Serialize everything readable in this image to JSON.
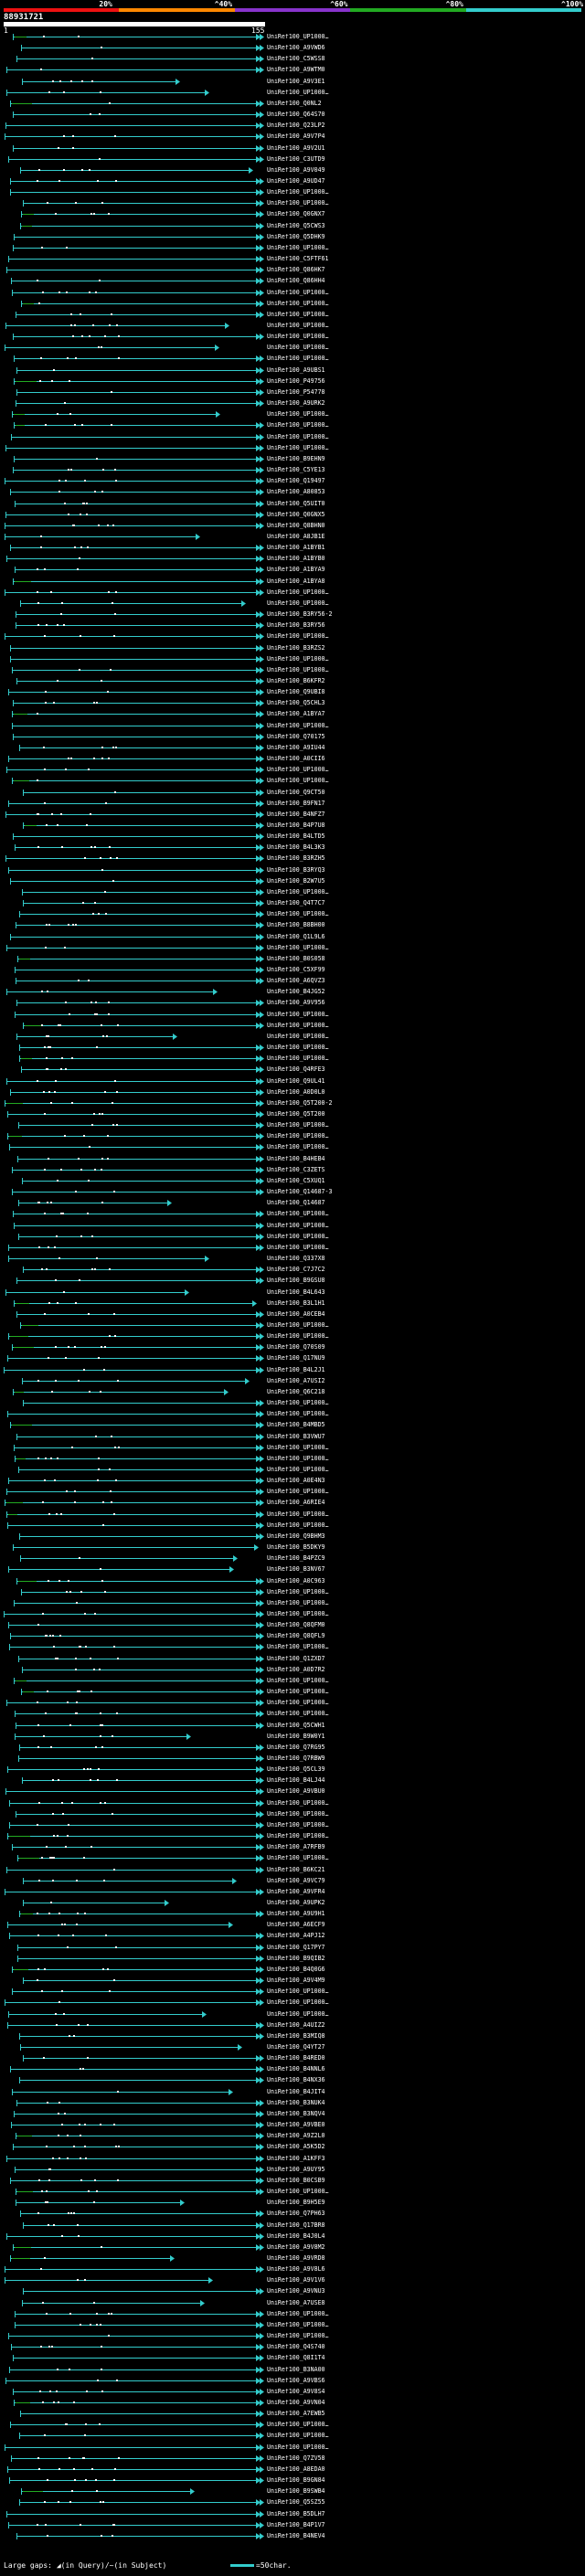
{
  "scale": {
    "labels": [
      "20%",
      "40%",
      "60%",
      "80%",
      "100%"
    ],
    "label_prefix_marks": [
      "",
      "^",
      "^",
      "^",
      "^"
    ],
    "colors": [
      "#ee1111",
      "#ff8800",
      "#8833cc",
      "#22aa22",
      "#33cccc"
    ]
  },
  "query": {
    "id": "88931721",
    "start_pos": "1",
    "end_pos": "155"
  },
  "hits": [
    "UniRef100_UP1000…",
    "UniRef100_A9VWD6",
    "UniRef100_C5WSS8",
    "UniRef100_A9WTM0",
    "UniRef100_A9V3E1",
    "UniRef100_UP1000…",
    "UniRef100_Q0NL2",
    "UniRef100_Q64S70",
    "UniRef100_Q23LP2",
    "UniRef100_A9V7P4",
    "UniRef100_A9V2U1",
    "UniRef100_C3UTD9",
    "UniRef100_A9V049",
    "UniRef100_A9UD47",
    "UniRef100_UP1000…",
    "UniRef100_UP1000…",
    "UniRef100_Q0GNX7",
    "UniRef100_Q5CWS3",
    "UniRef100_Q5DHK9",
    "UniRef100_UP1000…",
    "UniRef100_C5FTF61",
    "UniRef100_Q86HK7",
    "UniRef100_Q86HH4",
    "UniRef100_UP1000…",
    "UniRef100_UP1000…",
    "UniRef100_UP1000…",
    "UniRef100_UP1000…",
    "UniRef100_UP1000…",
    "UniRef100_UP1000…",
    "UniRef100_UP1000…",
    "UniRef100_A9UBS1",
    "UniRef100_P49756",
    "UniRef100_P54778",
    "UniRef100_A9URK2",
    "UniRef100_UP1000…",
    "UniRef100_UP1000…",
    "UniRef100_UP1000…",
    "UniRef100_UP1000…",
    "UniRef100_B9EHN9",
    "UniRef100_C5YE13",
    "UniRef100_Q19497",
    "UniRef100_A80853",
    "UniRef100_Q5UIT0",
    "UniRef100_Q0GNX5",
    "UniRef100_Q8BHN0",
    "UniRef100_A8JB1E",
    "UniRef100_A1BYB1",
    "UniRef100_A1BYB0",
    "UniRef100_A1BYA9",
    "UniRef100_A1BYA8",
    "UniRef100_UP1000…",
    "UniRef100_UP1000…",
    "UniRef100_B3RY56-2",
    "UniRef100_B3RY56",
    "UniRef100_UP1000…",
    "UniRef100_B3RZS2",
    "UniRef100_UP1000…",
    "UniRef100_UP1000…",
    "UniRef100_B6KFR2",
    "UniRef100_Q9UBI8",
    "UniRef100_Q5CHL3",
    "UniRef100_A1BYA7",
    "UniRef100_UP1000…",
    "UniRef100_Q70175",
    "UniRef100_A9IU44",
    "UniRef100_A0CII6",
    "UniRef100_UP1000…",
    "UniRef100_UP1000…",
    "UniRef100_Q9CT50",
    "UniRef100_B9FN17",
    "UniRef100_B4NFZ7",
    "UniRef100_B4P7U8",
    "UniRef100_B4LTD5",
    "UniRef100_B4L3K3",
    "UniRef100_B3RZH5",
    "UniRef100_B3RYQ3",
    "UniRef100_B2W7U5",
    "UniRef100_UP1000…",
    "UniRef100_Q4T7C7",
    "UniRef100_UP1000…",
    "UniRef100_B8BH00",
    "UniRef100_Q1L9L6",
    "UniRef100_UP1000…",
    "UniRef100_B0S058",
    "UniRef100_C5XF99",
    "UniRef100_A6QVZ3",
    "UniRef100_B4JG52",
    "UniRef100_A9V956",
    "UniRef100_UP1000…",
    "UniRef100_UP1000…",
    "UniRef100_UP1000…",
    "UniRef100_UP1000…",
    "UniRef100_UP1000…",
    "UniRef100_Q4RFE3",
    "UniRef100_Q9UL41",
    "UniRef100_A0D0L0",
    "UniRef100_Q5T200-2",
    "UniRef100_Q5T200",
    "UniRef100_UP1000…",
    "UniRef100_UP1000…",
    "UniRef100_UP1000…",
    "UniRef100_B4HEB4",
    "UniRef100_C3ZETS",
    "UniRef100_C5XUQ1",
    "UniRef100_Q14687-3",
    "UniRef100_Q14687",
    "UniRef100_UP1000…",
    "UniRef100_UP1000…",
    "UniRef100_UP1000…",
    "UniRef100_UP1000…",
    "UniRef100_Q337X8",
    "UniRef100_C7J7C2",
    "UniRef100_B9GSU8",
    "UniRef100_B4L643",
    "UniRef100_B3L1H1",
    "UniRef100_A0CEB4",
    "UniRef100_UP1000…",
    "UniRef100_UP1000…",
    "UniRef100_Q70S09",
    "UniRef100_Q17NU9",
    "UniRef100_B4L2J1",
    "UniRef100_A7USI2",
    "UniRef100_Q6C218",
    "UniRef100_UP1000…",
    "UniRef100_UP1000…",
    "UniRef100_B4MBD5",
    "UniRef100_B3VWU7",
    "UniRef100_UP1000…",
    "UniRef100_UP1000…",
    "UniRef100_UP1000…",
    "UniRef100_A0E4N3",
    "UniRef100_UP1000…",
    "UniRef100_A6RIE4",
    "UniRef100_UP1000…",
    "UniRef100_UP1000…",
    "UniRef100_Q9BHM3",
    "UniRef100_B5DKY9",
    "UniRef100_B4PZC9",
    "UniRef100_B3NV67",
    "UniRef100_A0C963",
    "UniRef100_UP1000…",
    "UniRef100_UP1000…",
    "UniRef100_UP1000…",
    "UniRef100_Q8QFM0",
    "UniRef100_Q8QFL9",
    "UniRef100_UP1000…",
    "UniRef100_Q1ZXD7",
    "UniRef100_A0D7R2",
    "UniRef100_UP1000…",
    "UniRef100_UP1000…",
    "UniRef100_UP1000…",
    "UniRef100_UP1000…",
    "UniRef100_Q5CWH1",
    "UniRef100_B9W0Y1",
    "UniRef100_Q7RG95",
    "UniRef100_Q7RBW9",
    "UniRef100_Q5CL39",
    "UniRef100_B4LJ44",
    "UniRef100_A9VBU0",
    "UniRef100_UP1000…",
    "UniRef100_UP1000…",
    "UniRef100_UP1000…",
    "UniRef100_UP1000…",
    "UniRef100_A7RFB9",
    "UniRef100_UP1000…",
    "UniRef100_B6KC21",
    "UniRef100_A9VC79",
    "UniRef100_A9VFR4",
    "UniRef100_A9UPK2",
    "UniRef100_A9U9H1",
    "UniRef100_A6ECF9",
    "UniRef100_A4PJ12",
    "UniRef100_Q17PY7",
    "UniRef100_B9QIB2",
    "UniRef100_B4Q0G6",
    "UniRef100_A9V4M9",
    "UniRef100_UP1000…",
    "UniRef100_UP1000…",
    "UniRef100_UP1000…",
    "UniRef100_A4UIZ2",
    "UniRef100_B3MIQ8",
    "UniRef100_Q4YT27",
    "UniRef100_B4RED0",
    "UniRef100_B4NNL6",
    "UniRef100_B4NX36",
    "UniRef100_B4JIT4",
    "UniRef100_B3NUK4",
    "UniRef100_B3NQV4",
    "UniRef100_A9VBE0",
    "UniRef100_A9Z2L0",
    "UniRef100_A5K5D2",
    "UniRef100_A1KFF3",
    "UniRef100_A9UY95",
    "UniRef100_B0CSB9",
    "UniRef100_UP1000…",
    "UniRef100_B9H5E9",
    "UniRef100_Q7PH63",
    "UniRef100_Q17BR8",
    "UniRef100_B4J0L4",
    "UniRef100_A9V8M2",
    "UniRef100_A9VRD8",
    "UniRef100_A9V8L6",
    "UniRef100_A9V1V6",
    "UniRef100_A9VNU3",
    "UniRef100_A7USE8",
    "UniRef100_UP1000…",
    "UniRef100_UP1000…",
    "UniRef100_UP1000…",
    "UniRef100_Q4S740",
    "UniRef100_Q8I1T4",
    "UniRef100_B3NA00",
    "UniRef100_A9VBS6",
    "UniRef100_A9V8S4",
    "UniRef100_A9VN04",
    "UniRef100_A7EWB5",
    "UniRef100_UP1000…",
    "UniRef100_UP1000…",
    "UniRef100_UP1000…",
    "UniRef100_Q7ZV58",
    "UniRef100_A8EDA0",
    "UniRef100_B9GN84",
    "UniRef100_B9SWB4",
    "UniRef100_Q5SZ55",
    "UniRef100_B5DLH7",
    "UniRef100_B4P1V7",
    "UniRef100_B4NEV4"
  ],
  "footer": {
    "gap_label": "Large gaps:",
    "gap_query": "(in Query)",
    "gap_separator": "/",
    "gap_subject": "(in Subject)",
    "scale_text": "=50char."
  },
  "colors": {
    "hit_line": "#33cccc",
    "hit_line_weak": "#22aa22",
    "background": "#000000"
  }
}
